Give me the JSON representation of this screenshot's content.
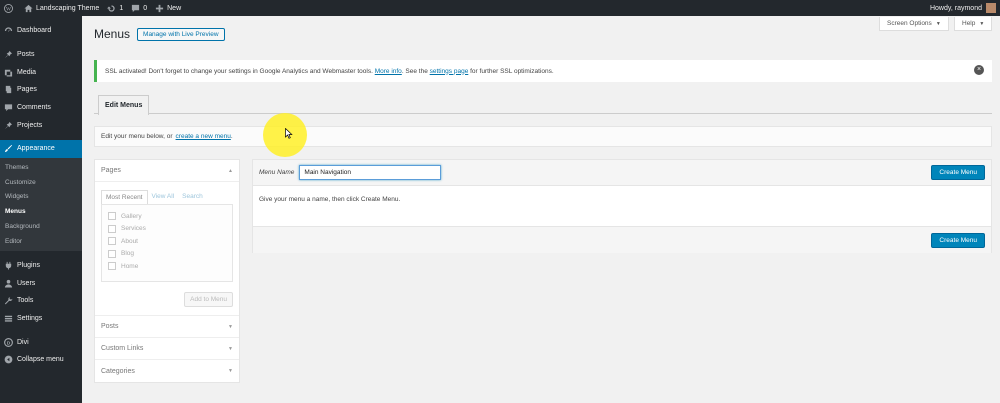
{
  "adminbar": {
    "site_name": "Landscaping Theme",
    "updates": "1",
    "comments": "0",
    "new_label": "New",
    "greeting": "Howdy, raymond"
  },
  "sidebar": {
    "items": [
      {
        "label": "Dashboard",
        "icon": "dashboard-icon"
      },
      {
        "label": "Posts",
        "icon": "pin-icon"
      },
      {
        "label": "Media",
        "icon": "media-icon"
      },
      {
        "label": "Pages",
        "icon": "page-icon"
      },
      {
        "label": "Comments",
        "icon": "comment-icon"
      },
      {
        "label": "Projects",
        "icon": "pin-icon"
      },
      {
        "label": "Appearance",
        "icon": "brush-icon"
      }
    ],
    "sub_items": [
      "Themes",
      "Customize",
      "Widgets",
      "Menus",
      "Background",
      "Editor"
    ],
    "items_after": [
      {
        "label": "Plugins",
        "icon": "plugin-icon"
      },
      {
        "label": "Users",
        "icon": "users-icon"
      },
      {
        "label": "Tools",
        "icon": "wrench-icon"
      },
      {
        "label": "Settings",
        "icon": "settings-icon"
      },
      {
        "label": "Divi",
        "icon": "divi-icon"
      },
      {
        "label": "Collapse menu",
        "icon": "collapse-icon"
      }
    ]
  },
  "header": {
    "screen_options": "Screen Options",
    "help": "Help",
    "title": "Menus",
    "preview_button": "Manage with Live Preview"
  },
  "notice": {
    "text1": "SSL activated!  Don't forget to change your settings in Google Analytics and Webmaster tools. ",
    "link1": "More info",
    "text2": ". See the ",
    "link2": "settings page",
    "text3": " for further SSL optimizations."
  },
  "tabs": {
    "edit_menus": "Edit Menus"
  },
  "manage": {
    "text": "Edit your menu below, or",
    "link": "create a new menu",
    "end": "."
  },
  "accordion": {
    "pages": "Pages",
    "inner_tabs": [
      "Most Recent",
      "View All",
      "Search"
    ],
    "page_list": [
      "Gallery",
      "Services",
      "About",
      "Blog",
      "Home"
    ],
    "add_button": "Add to Menu",
    "posts": "Posts",
    "custom_links": "Custom Links",
    "categories": "Categories"
  },
  "menu_editor": {
    "name_label": "Menu Name",
    "name_value": "Main Navigation",
    "create_button": "Create Menu",
    "instructions": "Give your menu a name, then click Create Menu.",
    "create_button_bottom": "Create Menu"
  },
  "colors": {
    "sidebar_bg": "#23282d",
    "accent": "#0073aa",
    "button_primary": "#0085ba",
    "notice_success": "#46b450",
    "cursor_highlight": "#fff028"
  }
}
